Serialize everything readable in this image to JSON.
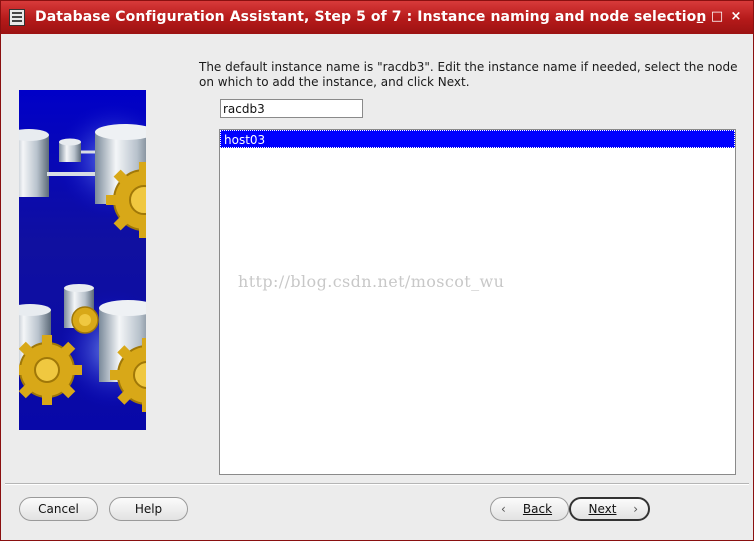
{
  "window": {
    "title": "Database Configuration Assistant, Step 5 of 7 : Instance naming and node selection",
    "minimize_glyph": "_",
    "maximize_glyph": "□",
    "close_glyph": "×"
  },
  "instructions": "The default instance name is \"racdb3\". Edit the instance name if needed, select the node on which to add the instance, and click Next.",
  "instance_name": {
    "value": "racdb3"
  },
  "nodes": {
    "items": [
      "host03"
    ],
    "selected_index": 0
  },
  "watermark": "http://blog.csdn.net/moscot_wu",
  "buttons": {
    "cancel": "Cancel",
    "help": "Help",
    "back": "Back",
    "next": "Next"
  },
  "colors": {
    "titlebar": "#b51a1a",
    "selection": "#0000ff",
    "art_background": "#0000c8",
    "gear": "#e0b020"
  }
}
